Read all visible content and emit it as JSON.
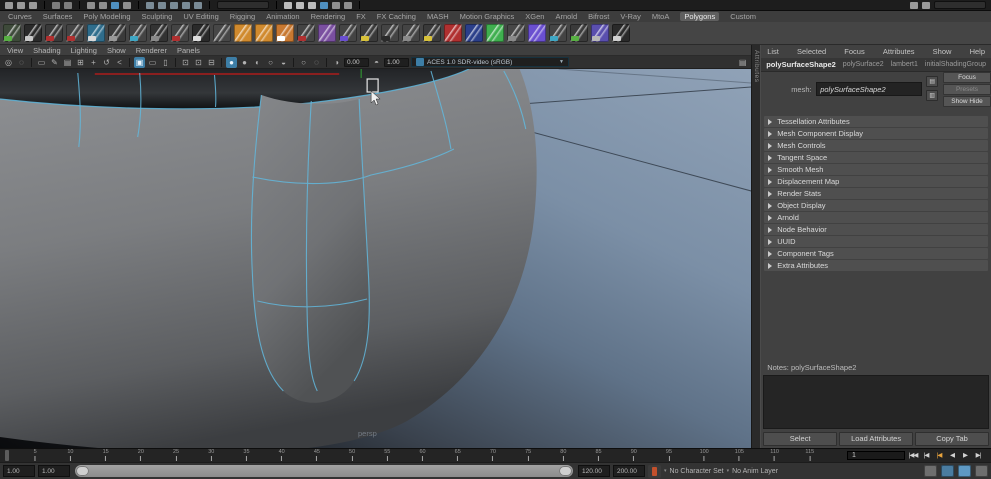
{
  "status_line": {
    "left_icons": [
      {
        "t": "t",
        "c": "#9a9a9a"
      },
      {
        "t": "t",
        "c": "#9a9a9a"
      },
      {
        "t": "t",
        "c": "#9a9a9a"
      },
      {
        "t": "s"
      },
      {
        "t": "t",
        "c": "#7d7d7d"
      },
      {
        "t": "t",
        "c": "#7d7d7d"
      },
      {
        "t": "s"
      },
      {
        "t": "t",
        "c": "#8f8f8f"
      },
      {
        "t": "t",
        "c": "#8f8f8f"
      },
      {
        "t": "t",
        "c": "#4f8fbf"
      },
      {
        "t": "t",
        "c": "#8f8f8f"
      },
      {
        "t": "s"
      },
      {
        "t": "t",
        "c": "#7a8b96"
      },
      {
        "t": "t",
        "c": "#7a8b96"
      },
      {
        "t": "t",
        "c": "#7a8b96"
      },
      {
        "t": "t",
        "c": "#7a8b96"
      },
      {
        "t": "t",
        "c": "#7a8b96"
      },
      {
        "t": "s"
      },
      {
        "t": "f"
      },
      {
        "t": "s"
      },
      {
        "t": "t",
        "c": "#bdbdbd"
      },
      {
        "t": "t",
        "c": "#bdbdbd"
      },
      {
        "t": "t",
        "c": "#bdbdbd"
      },
      {
        "t": "t",
        "c": "#4f8fbf"
      },
      {
        "t": "t",
        "c": "#8f8f8f"
      },
      {
        "t": "t",
        "c": "#8f8f8f"
      },
      {
        "t": "s"
      }
    ],
    "right_icons": [
      {
        "t": "t",
        "c": "#9a9a9a"
      },
      {
        "t": "t",
        "c": "#9a9a9a"
      },
      {
        "t": "f"
      }
    ]
  },
  "shelf": {
    "tabs": [
      {
        "label": "Curves"
      },
      {
        "label": "Surfaces"
      },
      {
        "label": "Poly Modeling"
      },
      {
        "label": "Sculpting"
      },
      {
        "label": "UV Editing"
      },
      {
        "label": "Rigging"
      },
      {
        "label": "Animation"
      },
      {
        "label": "Rendering"
      },
      {
        "label": "FX"
      },
      {
        "label": "FX Caching"
      },
      {
        "label": "MASH"
      },
      {
        "label": "Motion Graphics"
      },
      {
        "label": "XGen"
      },
      {
        "label": "Arnold"
      },
      {
        "label": "Bifrost"
      },
      {
        "label": "V-Ray"
      },
      {
        "label": "MtoA"
      },
      {
        "label": "Polygons",
        "active": true
      },
      {
        "label": "Custom"
      }
    ],
    "icons": [
      {
        "c": "#3e4a3a",
        "b": "#58b043"
      },
      {
        "c": "#2a2a2a",
        "b": "#c8c8c8"
      },
      {
        "c": "#3a3a3a",
        "b": "#b03030"
      },
      {
        "c": "#444444",
        "b": "#b03030"
      },
      {
        "c": "#2f6d8c",
        "b": "#d8d8d8"
      },
      {
        "c": "#3a3a3a",
        "b": "#999999"
      },
      {
        "c": "#444444",
        "b": "#3fa7c4"
      },
      {
        "c": "#333333",
        "b": "#8a8a8a"
      },
      {
        "c": "#444444",
        "b": "#b03030"
      },
      {
        "c": "#2a2a2a",
        "b": "#dddddd"
      },
      {
        "c": "#474747"
      },
      {
        "c": "#d08a2e"
      },
      {
        "c": "#d08a2e"
      },
      {
        "c": "#c87830",
        "b": "#ffffff"
      },
      {
        "c": "#444444",
        "b": "#b03030"
      },
      {
        "c": "#7a4fa0"
      },
      {
        "c": "#444444",
        "b": "#6a4fd0"
      },
      {
        "c": "#3a3a3a",
        "b": "#d8c23a"
      },
      {
        "c": "#444444",
        "b": "#2a2a2a"
      },
      {
        "c": "#444444",
        "b": "#8a8a8a"
      },
      {
        "c": "#3a3a3a",
        "b": "#d8c23a"
      },
      {
        "c": "#b03030"
      },
      {
        "c": "#2b3f8a"
      },
      {
        "c": "#3faf4f"
      },
      {
        "c": "#474747",
        "b": "#8a8a8a"
      },
      {
        "c": "#6a4fd0"
      },
      {
        "c": "#444444",
        "b": "#3fa7c4"
      },
      {
        "c": "#3a3a3a",
        "b": "#58b043"
      },
      {
        "c": "#5a4fae",
        "b": "#b8b8b8"
      },
      {
        "c": "#2a2a2a",
        "b": "#d0d0d0"
      }
    ]
  },
  "viewport": {
    "menu_items": [
      "View",
      "Shading",
      "Lighting",
      "Show",
      "Renderer",
      "Panels"
    ],
    "toolbar": {
      "items": [
        {
          "t": "i",
          "g": "◎"
        },
        {
          "t": "i",
          "g": "◌"
        },
        {
          "t": "s"
        },
        {
          "t": "i",
          "g": "▭"
        },
        {
          "t": "i",
          "g": "✎"
        },
        {
          "t": "i",
          "g": "▤"
        },
        {
          "t": "i",
          "g": "⊞"
        },
        {
          "t": "i",
          "g": "+"
        },
        {
          "t": "i",
          "g": "↺"
        },
        {
          "t": "i",
          "g": "<"
        },
        {
          "t": "s"
        },
        {
          "t": "i",
          "g": "▣",
          "hl": true
        },
        {
          "t": "i",
          "g": "▭"
        },
        {
          "t": "i",
          "g": "▯"
        },
        {
          "t": "s"
        },
        {
          "t": "i",
          "g": "⊡"
        },
        {
          "t": "i",
          "g": "⊡"
        },
        {
          "t": "i",
          "g": "⊟"
        },
        {
          "t": "s"
        },
        {
          "t": "i",
          "g": "●",
          "hl": true
        },
        {
          "t": "i",
          "g": "●"
        },
        {
          "t": "i",
          "g": "◐"
        },
        {
          "t": "i",
          "g": "○"
        },
        {
          "t": "i",
          "g": "◒"
        },
        {
          "t": "s"
        },
        {
          "t": "i",
          "g": "○"
        },
        {
          "t": "i",
          "g": "◌"
        },
        {
          "t": "s"
        },
        {
          "t": "i",
          "g": "◑"
        },
        {
          "t": "f",
          "v": "0.00"
        },
        {
          "t": "i",
          "g": "◓"
        },
        {
          "t": "f",
          "v": "1.00"
        },
        {
          "t": "dd",
          "v": "ACES 1.0 SDR-video (sRGB)"
        },
        {
          "t": "i",
          "g": "▤",
          "right": true
        }
      ]
    },
    "camera_label": "persp"
  },
  "splitter": {
    "label": "Attributes"
  },
  "attribute_editor": {
    "menu_items": [
      "List",
      "Selected",
      "Focus",
      "Attributes",
      "Show",
      "Help"
    ],
    "tabs": [
      {
        "label": "polySurfaceShape2",
        "active": true
      },
      {
        "label": "polySurface2"
      },
      {
        "label": "lambert1"
      },
      {
        "label": "initialShadingGroup"
      }
    ],
    "name_label": "mesh:",
    "name_value": "polySurfaceShape2",
    "mini_buttons": [
      "▤",
      "▥"
    ],
    "side_buttons": [
      {
        "label": "Focus"
      },
      {
        "label": "Presets",
        "dim": true
      },
      {
        "label": "Show Hide"
      }
    ],
    "sections": [
      "Tessellation Attributes",
      "Mesh Component Display",
      "Mesh Controls",
      "Tangent Space",
      "Smooth Mesh",
      "Displacement Map",
      "Render Stats",
      "Object Display",
      "Arnold",
      "Node Behavior",
      "UUID",
      "Component Tags",
      "Extra Attributes"
    ],
    "notes_label": "Notes: polySurfaceShape2",
    "bottom_buttons": [
      "Select",
      "Load Attributes",
      "Copy Tab"
    ]
  },
  "timeline": {
    "range_end": 120,
    "tick_labels": [
      5,
      10,
      15,
      20,
      25,
      30,
      35,
      40,
      45,
      50,
      55,
      60,
      65,
      70,
      75,
      80,
      85,
      90,
      95,
      100,
      105,
      110,
      115
    ],
    "current_frame": "1",
    "playhead_frame": 1,
    "transport": [
      {
        "g": "|◀◀"
      },
      {
        "g": "|◀"
      },
      {
        "g": "|◀",
        "hl": true
      },
      {
        "g": "◀"
      },
      {
        "g": "▶"
      },
      {
        "g": "▶|"
      }
    ]
  },
  "range_slider": {
    "anim_start": "1.00",
    "play_start": "1.00",
    "play_end": "120.00",
    "anim_end": "200.00",
    "character_set": "No Character Set",
    "anim_layer": "No Anim Layer",
    "right_icons": [
      "#6e6e6e",
      "#4a7ca0",
      "#5e99c4",
      "#6e6e6e"
    ]
  },
  "colors": {
    "accent": "#3d7ea6",
    "wireframe": "#62b8dd",
    "selected_edge": "#8a1f1f",
    "hull": "#808284",
    "sky_top": "#90a2b7",
    "sky_bottom": "#0a0b0d"
  }
}
